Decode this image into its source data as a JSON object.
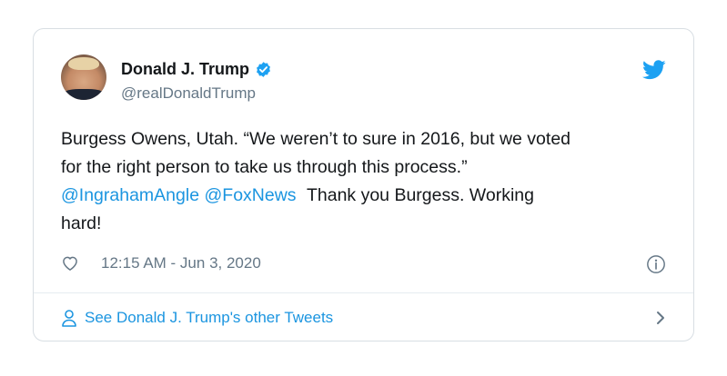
{
  "tweet": {
    "author": {
      "display_name": "Donald J. Trump",
      "handle": "@realDonaldTrump",
      "verified": true
    },
    "text_parts": {
      "line1": "Burgess Owens, Utah. “We weren’t to sure in 2016, but we voted",
      "line2": "for the right person to take us through this process.”",
      "mention1": "@IngrahamAngle",
      "mention2": "@FoxNews",
      "after_mentions": "Thank you Burgess. Working",
      "line4": "hard!"
    },
    "timestamp": "12:15 AM - Jun 3, 2020",
    "footer_link": "See Donald J. Trump's other Tweets"
  },
  "icons": {
    "brand": "twitter-bird-icon",
    "verified": "verified-badge-icon",
    "like": "heart-icon",
    "info": "info-icon",
    "person": "person-icon",
    "chevron": "chevron-right-icon"
  },
  "colors": {
    "accent": "#1b95e0",
    "text": "#14171a",
    "muted": "#657786",
    "border": "#d8dee3"
  }
}
